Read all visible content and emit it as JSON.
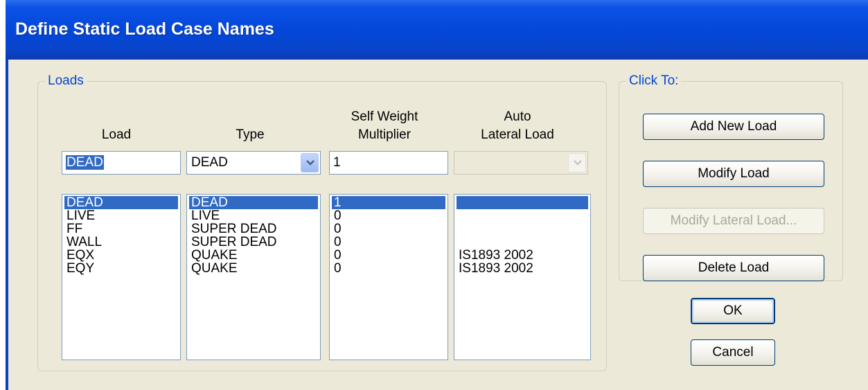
{
  "window": {
    "title": "Define Static Load Case Names"
  },
  "loads_group": {
    "legend": "Loads",
    "columns": {
      "load": "Load",
      "type": "Type",
      "self_weight": "Self Weight\nMultiplier",
      "auto_lateral": "Auto\nLateral Load"
    },
    "edit": {
      "load_value": "DEAD",
      "type_value": "DEAD",
      "multiplier_value": "1",
      "auto_lateral_value": ""
    },
    "rows": [
      {
        "load": "DEAD",
        "type": "DEAD",
        "multiplier": "1",
        "auto_lateral": ""
      },
      {
        "load": "LIVE",
        "type": "LIVE",
        "multiplier": "0",
        "auto_lateral": ""
      },
      {
        "load": "FF",
        "type": "SUPER DEAD",
        "multiplier": "0",
        "auto_lateral": ""
      },
      {
        "load": "WALL",
        "type": "SUPER DEAD",
        "multiplier": "0",
        "auto_lateral": ""
      },
      {
        "load": "EQX",
        "type": "QUAKE",
        "multiplier": "0",
        "auto_lateral": "IS1893 2002"
      },
      {
        "load": "EQY",
        "type": "QUAKE",
        "multiplier": "0",
        "auto_lateral": "IS1893 2002"
      }
    ],
    "selected_row": 0
  },
  "click_to_group": {
    "legend": "Click To:",
    "add_new_load": "Add New Load",
    "modify_load": "Modify Load",
    "modify_lateral_load": "Modify Lateral Load...",
    "delete_load": "Delete Load"
  },
  "buttons": {
    "ok": "OK",
    "cancel": "Cancel"
  },
  "icons": {
    "combo_arrow": "chevron-down-icon"
  },
  "colors": {
    "titlebar": "#0346d8",
    "selection": "#316ac5",
    "dialog_bg": "#ece9d8",
    "legend_text": "#0046d5"
  }
}
